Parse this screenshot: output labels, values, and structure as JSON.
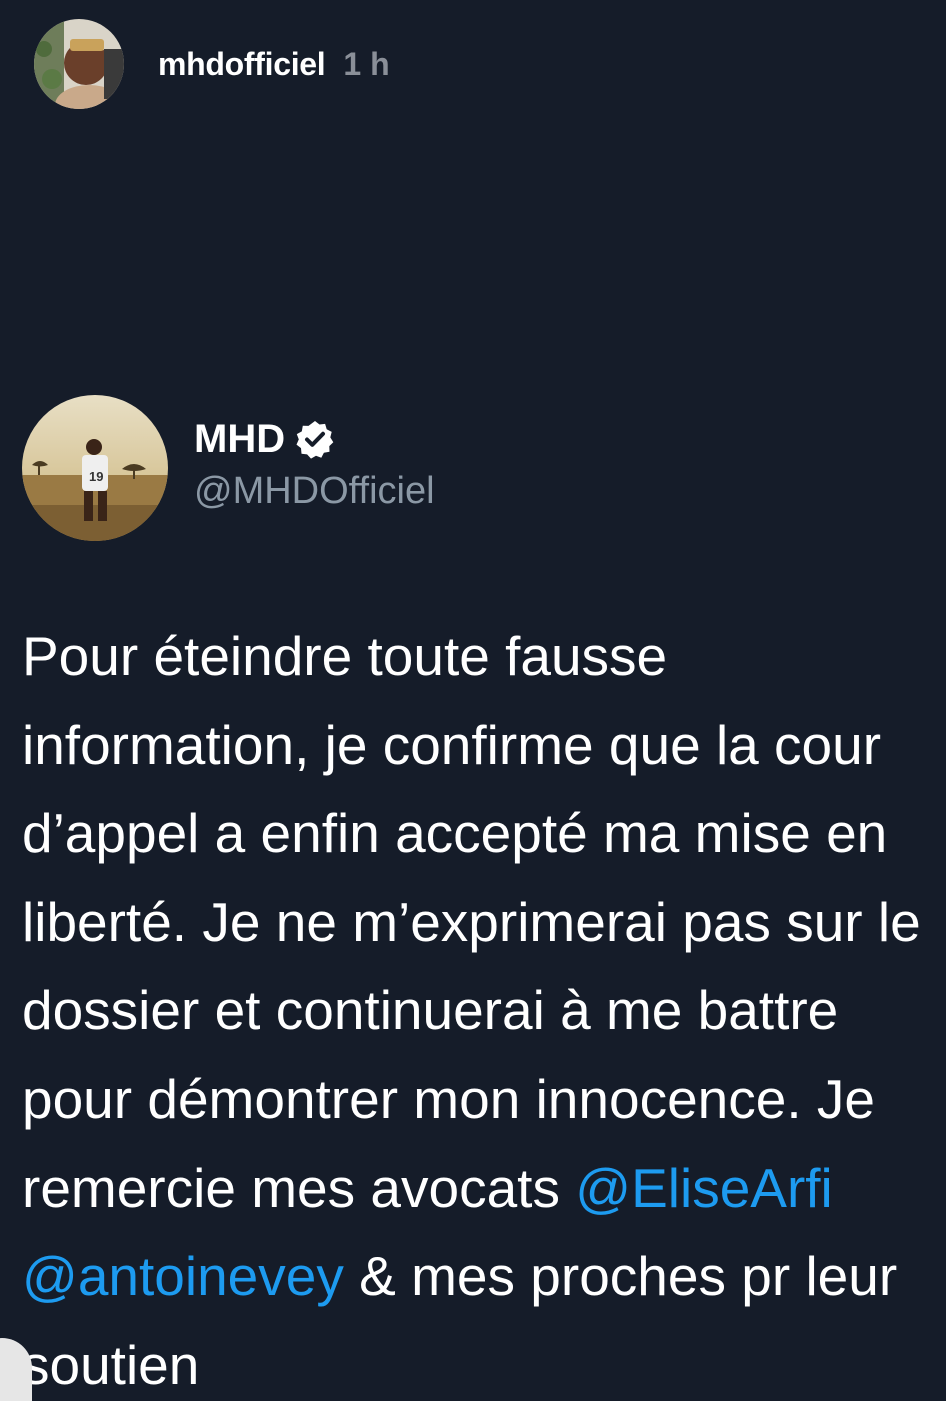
{
  "story": {
    "username": "mhdofficiel",
    "time": "1 h",
    "avatar_icon": "profile-avatar"
  },
  "tweet": {
    "display_name": "MHD",
    "verified_icon": "verified-badge-icon",
    "handle": "@MHDOfficiel",
    "avatar_icon": "profile-avatar",
    "lines": [
      {
        "segments": [
          {
            "text": "Pour éteindre toute fausse",
            "mention": false
          }
        ]
      },
      {
        "segments": [
          {
            "text": "information, je confirme que la cour",
            "mention": false
          }
        ]
      },
      {
        "segments": [
          {
            "text": "d’appel a enfin accepté ma mise en",
            "mention": false
          }
        ]
      },
      {
        "segments": [
          {
            "text": "liberté. Je ne m’exprimerai pas sur le",
            "mention": false
          }
        ]
      },
      {
        "segments": [
          {
            "text": "dossier et continuerai à me battre",
            "mention": false
          }
        ]
      },
      {
        "segments": [
          {
            "text": "pour démontrer mon innocence. Je",
            "mention": false
          }
        ]
      },
      {
        "segments": [
          {
            "text": "remercie mes avocats ",
            "mention": false
          },
          {
            "text": "@EliseArfi",
            "mention": true
          }
        ]
      },
      {
        "segments": [
          {
            "text": "@antoinevey",
            "mention": true
          },
          {
            "text": " & mes proches pr leur",
            "mention": false
          }
        ]
      },
      {
        "segments": [
          {
            "text": "soutien",
            "mention": false
          }
        ]
      }
    ]
  },
  "colors": {
    "background": "#151c29",
    "mention": "#1d9bf0",
    "handle": "#8b98a5",
    "time": "#8a8f98"
  }
}
